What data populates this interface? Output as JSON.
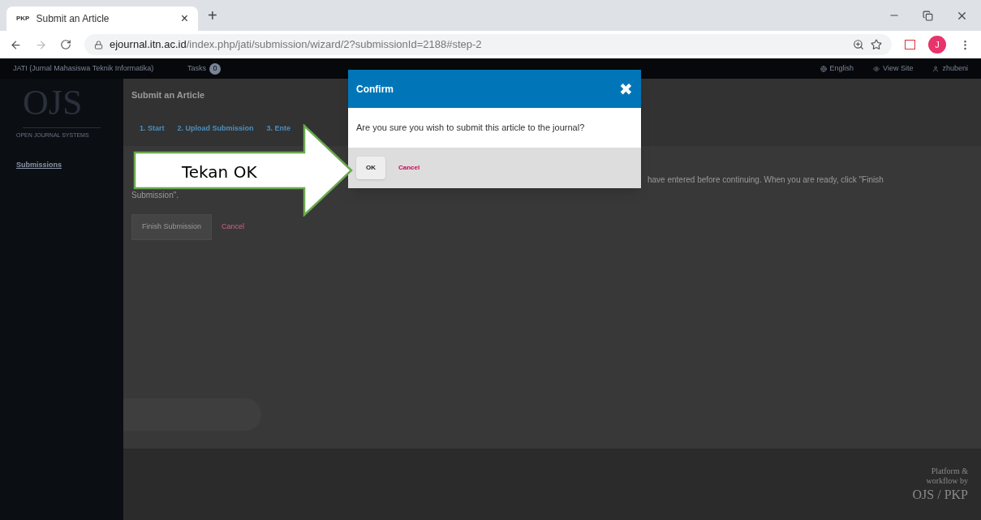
{
  "browser": {
    "tab_title": "Submit an Article",
    "tab_favicon": "PKP",
    "tab_close": "×",
    "new_tab": "+",
    "url_host": "ejournal.itn.ac.id",
    "url_path": "/index.php/jati/submission/wizard/2?submissionId=2188#step-2",
    "profile_initial": "J"
  },
  "topbar": {
    "journal": "JATI (Jurnal Mahasiswa Teknik Informatika)",
    "tasks_label": "Tasks",
    "tasks_count": "0",
    "links": [
      {
        "label": "English"
      },
      {
        "label": "View Site"
      },
      {
        "label": "zhubeni"
      }
    ]
  },
  "sidebar": {
    "logo": "OJS",
    "logo_sub": "OPEN JOURNAL SYSTEMS",
    "items": [
      {
        "label": "Submissions",
        "selected": true
      }
    ]
  },
  "page": {
    "title": "Submit an Article",
    "steps": [
      {
        "label": "1. Start",
        "selected": false
      },
      {
        "label": "2. Upload Submission",
        "selected": false
      },
      {
        "label": "3. Ente",
        "selected": false
      }
    ],
    "notice_right": "have entered before continuing. When you are ready, click \"Finish",
    "notice_left": "Submission\".",
    "primary_button": "Finish Submission",
    "cancel_link": "Cancel"
  },
  "footer": {
    "credit_lines": [
      "Platform &",
      "workflow by",
      "OJS / PKP"
    ]
  },
  "dialog": {
    "title": "Confirm",
    "close": "✖",
    "message": "Are you sure you wish to submit this article to the journal?",
    "ok": "OK",
    "cancel": "Cancel"
  },
  "callout": {
    "text": "Tekan OK"
  }
}
